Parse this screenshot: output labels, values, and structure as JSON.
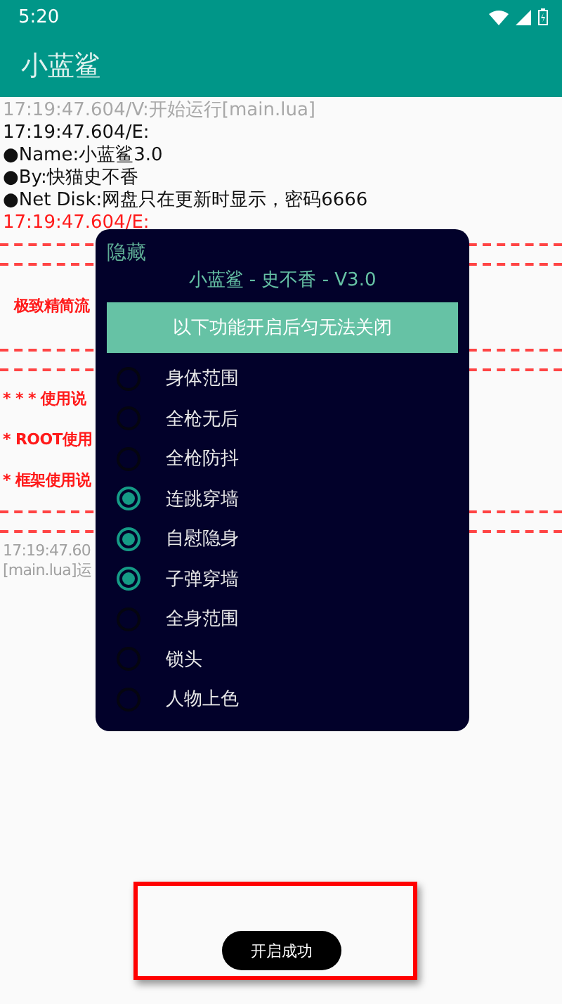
{
  "status_bar": {
    "time": "5:20"
  },
  "app_bar": {
    "title": "小蓝鲨"
  },
  "log": [
    {
      "kind": "grey",
      "text": "17:19:47.604/V:开始运行[main.lua]"
    },
    {
      "kind": "black",
      "text": "17:19:47.604/E:"
    },
    {
      "kind": "black",
      "text": "●Name:小蓝鲨3.0"
    },
    {
      "kind": "black",
      "text": "●By:快猫史不香"
    },
    {
      "kind": "black",
      "text": "●Net Disk:网盘只在更新时显示，密码6666"
    },
    {
      "kind": "red",
      "text": "17:19:47.604/E:"
    },
    {
      "kind": "dash"
    },
    {
      "kind": "dash"
    },
    {
      "kind": "heading",
      "text": "极致精简流"
    },
    {
      "kind": "dash"
    },
    {
      "kind": "dash"
    },
    {
      "kind": "redbold",
      "text": "* * * 使用说"
    },
    {
      "kind": "redbold",
      "text": "* ROOT使用"
    },
    {
      "kind": "redbold",
      "text": "* 框架使用说"
    },
    {
      "kind": "dash"
    },
    {
      "kind": "dash"
    },
    {
      "kind": "greycut",
      "text": "17:19:47.60"
    },
    {
      "kind": "greycut",
      "text": "[main.lua]运"
    }
  ],
  "dialog": {
    "hide_label": "隐藏",
    "title": "小蓝鲨 - 史不香 - V3.0",
    "banner": "以下功能开启后匀无法关闭",
    "options": [
      {
        "label": "身体范围",
        "selected": false
      },
      {
        "label": "全枪无后",
        "selected": false
      },
      {
        "label": "全枪防抖",
        "selected": false
      },
      {
        "label": "连跳穿墙",
        "selected": true
      },
      {
        "label": "自慰隐身",
        "selected": true
      },
      {
        "label": "子弹穿墙",
        "selected": true
      },
      {
        "label": "全身范围",
        "selected": false
      },
      {
        "label": "锁头",
        "selected": false
      },
      {
        "label": "人物上色",
        "selected": false
      }
    ]
  },
  "toast": {
    "text": "开启成功"
  }
}
